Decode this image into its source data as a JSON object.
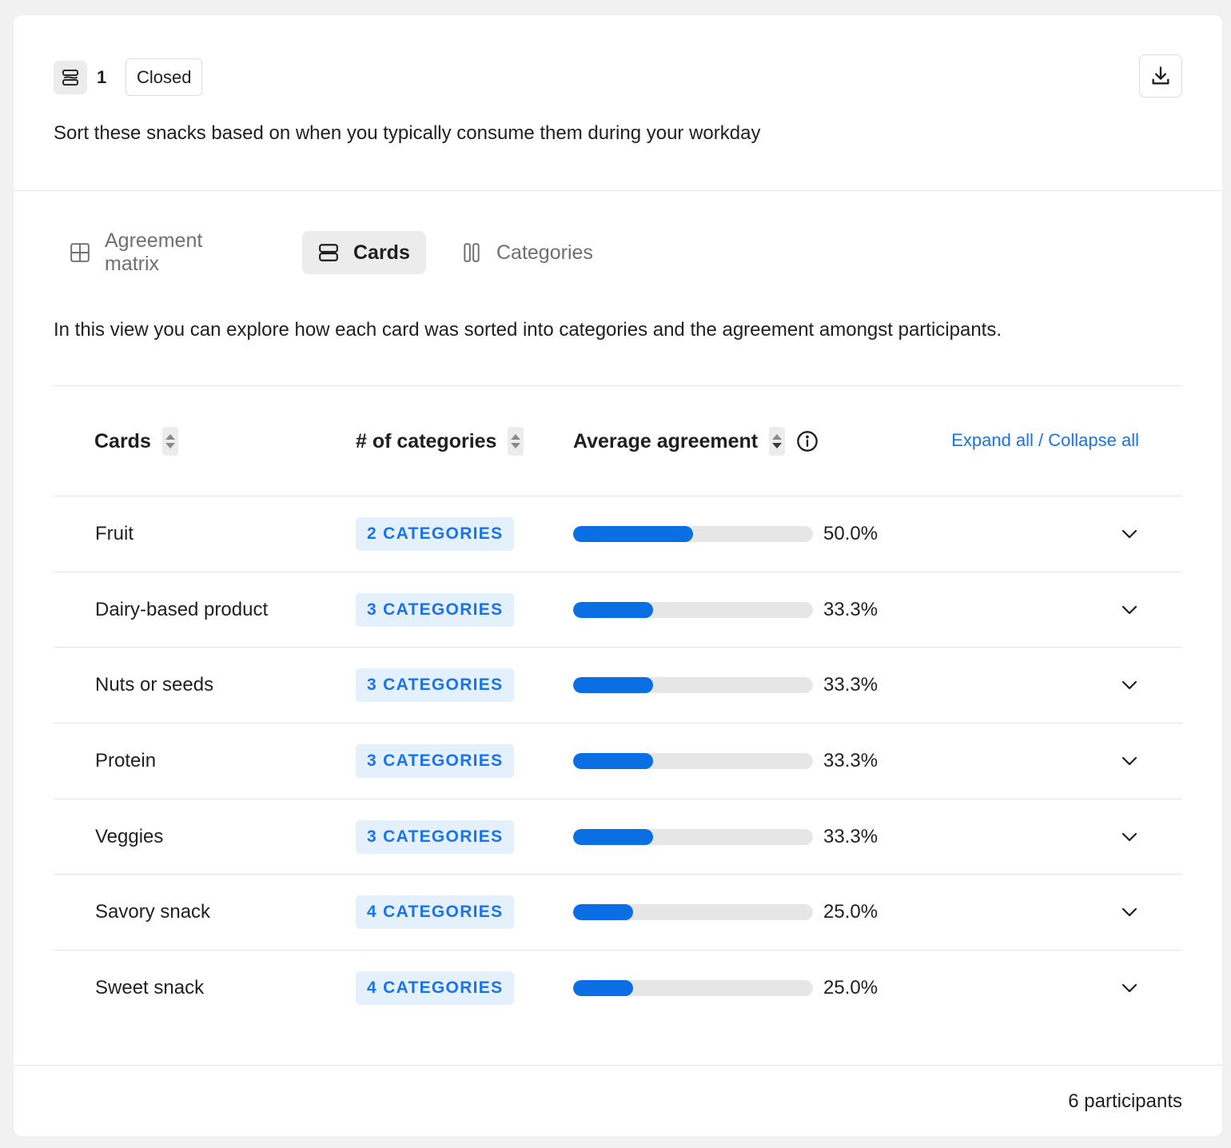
{
  "question": {
    "type_icon": "card-sort-icon",
    "number": "1",
    "status": "Closed",
    "text": "Sort these snacks based on when you typically consume them during your workday",
    "download_icon": "download-icon"
  },
  "tabs": [
    {
      "label": "Agreement matrix",
      "icon": "grid-icon",
      "active": false
    },
    {
      "label": "Cards",
      "icon": "cards-icon",
      "active": true
    },
    {
      "label": "Categories",
      "icon": "columns-icon",
      "active": false
    }
  ],
  "view_description": "In this view you can explore how each card was sorted into categories and the agreement amongst participants.",
  "table": {
    "columns": {
      "cards": "Cards",
      "categories": "# of categories",
      "agreement": "Average agreement"
    },
    "expand_collapse": "Expand all / Collapse all",
    "rows": [
      {
        "card": "Fruit",
        "categories": "2 CATEGORIES",
        "agreement": 0.5,
        "agreement_label": "50.0%"
      },
      {
        "card": "Dairy-based product",
        "categories": "3 CATEGORIES",
        "agreement": 0.333,
        "agreement_label": "33.3%"
      },
      {
        "card": "Nuts or seeds",
        "categories": "3 CATEGORIES",
        "agreement": 0.333,
        "agreement_label": "33.3%"
      },
      {
        "card": "Protein",
        "categories": "3 CATEGORIES",
        "agreement": 0.333,
        "agreement_label": "33.3%"
      },
      {
        "card": "Veggies",
        "categories": "3 CATEGORIES",
        "agreement": 0.333,
        "agreement_label": "33.3%"
      },
      {
        "card": "Savory snack",
        "categories": "4 CATEGORIES",
        "agreement": 0.25,
        "agreement_label": "25.0%"
      },
      {
        "card": "Sweet snack",
        "categories": "4 CATEGORIES",
        "agreement": 0.25,
        "agreement_label": "25.0%"
      }
    ]
  },
  "footer": {
    "participants": "6 participants"
  },
  "colors": {
    "accent": "#1a73e8",
    "bar_fill": "#0b6fe3",
    "bar_track": "#e6e6e6",
    "badge_bg": "#e5f0fd"
  }
}
